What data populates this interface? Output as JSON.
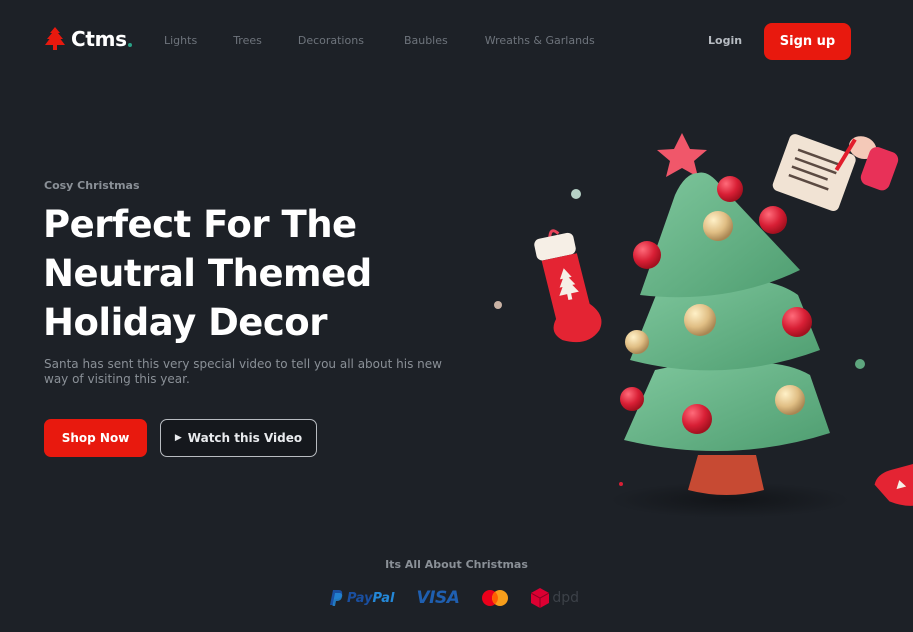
{
  "brand": {
    "name": "Ctms",
    "logo_icon": "tree-icon",
    "accent": "#e8190e",
    "dot_color": "#2aa187",
    "background": "#1d2127"
  },
  "nav": {
    "links": [
      {
        "label": "Lights"
      },
      {
        "label": "Trees"
      },
      {
        "label": "Decorations"
      },
      {
        "label": "Baubles"
      },
      {
        "label": "Wreaths & Garlands"
      }
    ],
    "login_label": "Login",
    "signup_label": "Sign up"
  },
  "hero": {
    "eyebrow": "Cosy Christmas",
    "headline_lines": [
      "Perfect For The",
      "Neutral Themed",
      "Holiday Decor"
    ],
    "subtext": "Santa has sent this very special video to tell you all about his new way of visiting this year.",
    "primary_button": "Shop Now",
    "secondary_button": "Watch this Video",
    "secondary_icon": "play-icon",
    "illustration": "christmas-tree-illustration"
  },
  "footer": {
    "label": "Its All About Christmas",
    "partners": [
      {
        "name": "PayPal",
        "part1": "Pay",
        "part2": "Pal"
      },
      {
        "name": "VISA"
      },
      {
        "name": "Mastercard"
      },
      {
        "name": "dpd"
      }
    ]
  }
}
